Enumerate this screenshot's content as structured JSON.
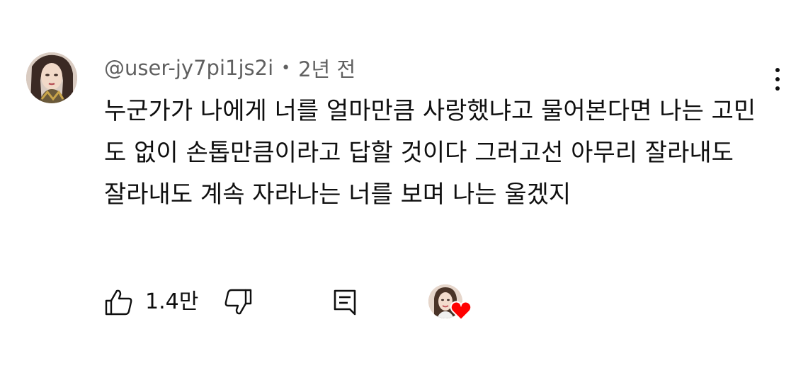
{
  "comment": {
    "username": "@user-jy7pi1js2i",
    "separator": "•",
    "time": "2년 전",
    "text": "누군가가 나에게 너를 얼마만큼 사랑했냐고 물어본다면 나는 고민도 없이 손톱만큼이라고 답할 것이다 그러고선 아무리 잘라내도 잘라내도 계속 자라나는 너를 보며 나는 울겠지",
    "like_count": "1.4만",
    "icons": {
      "avatar": "user-avatar",
      "menu": "more-vert-icon",
      "like": "thumb-up-icon",
      "dislike": "thumb-down-icon",
      "reply": "comment-reply-icon",
      "creator_heart": "creator-heart-icon"
    },
    "colors": {
      "text": "#0f0f0f",
      "meta": "#606060",
      "heart": "#ff0000"
    }
  }
}
